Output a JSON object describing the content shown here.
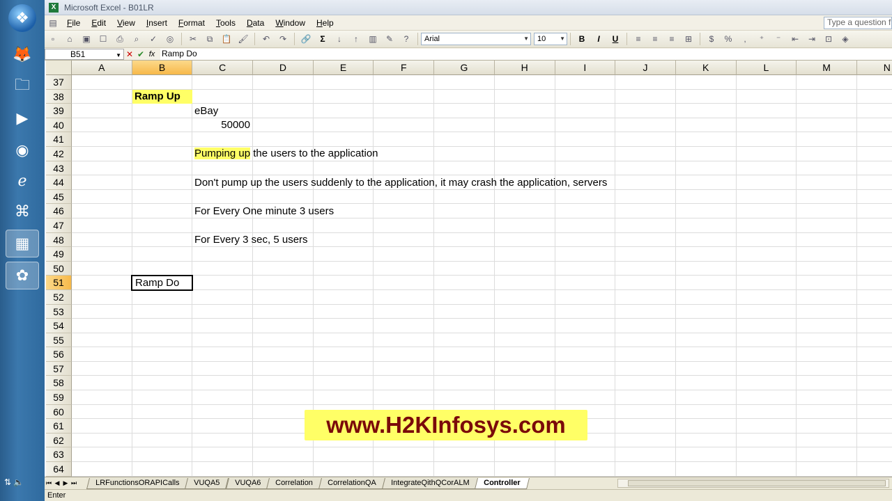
{
  "window": {
    "title": "Microsoft Excel - B01LR"
  },
  "menu": [
    "File",
    "Edit",
    "View",
    "Insert",
    "Format",
    "Tools",
    "Data",
    "Window",
    "Help"
  ],
  "ask_placeholder": "Type a question f",
  "toolbar": {
    "font": "Arial",
    "size": "10",
    "bold": "B",
    "italic": "I",
    "underline": "U"
  },
  "formula": {
    "namebox": "B51",
    "content": "Ramp Do",
    "fx": "fx"
  },
  "columns": [
    "A",
    "B",
    "C",
    "D",
    "E",
    "F",
    "G",
    "H",
    "I",
    "J",
    "K",
    "L",
    "M",
    "N"
  ],
  "rows": [
    "37",
    "38",
    "39",
    "40",
    "41",
    "42",
    "43",
    "44",
    "45",
    "46",
    "47",
    "48",
    "49",
    "50",
    "51",
    "52",
    "53",
    "54",
    "55",
    "56",
    "57",
    "58",
    "59",
    "60",
    "61",
    "62",
    "63",
    "64"
  ],
  "cells": {
    "b38": "Ramp Up",
    "c39": "eBay",
    "c40": "50000",
    "c42_hl": "Pumping up",
    "c42_rest": " the users to the application",
    "c44": "Don't pump up the users suddenly to the application, it may crash the application, servers",
    "c46": "For Every One minute 3 users",
    "c48": "For Every 3 sec, 5 users",
    "b51": "Ramp Do"
  },
  "watermark": "www.H2KInfosys.com",
  "sheets": [
    "LRFunctionsORAPICalls",
    "VUQA5",
    "VUQA6",
    "Correlation",
    "CorrelationQA",
    "IntegrateQithQCorALM",
    "Controller"
  ],
  "status": "Enter"
}
